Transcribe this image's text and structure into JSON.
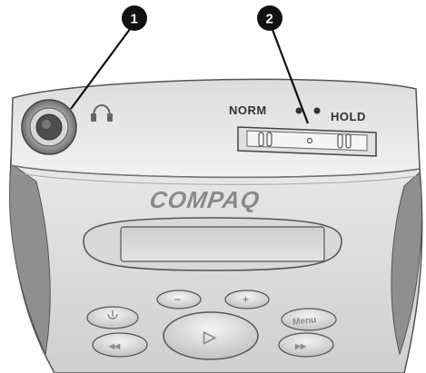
{
  "callouts": [
    {
      "number": "1",
      "target": "headphone-jack"
    },
    {
      "number": "2",
      "target": "hold-switch"
    }
  ],
  "switch": {
    "left_label": "NORM",
    "right_label": "HOLD"
  },
  "brand": "COMPAQ",
  "buttons": {
    "minus": "−",
    "plus": "+",
    "play": "▷",
    "menu": "Menu",
    "rewind": "◂◂",
    "forward": "▸▸"
  },
  "colors": {
    "callout_fill": "#111111",
    "body_light": "#e6e6e6",
    "body_mid": "#c8c8c8",
    "body_dark": "#9a9a9a",
    "outline": "#555555"
  }
}
